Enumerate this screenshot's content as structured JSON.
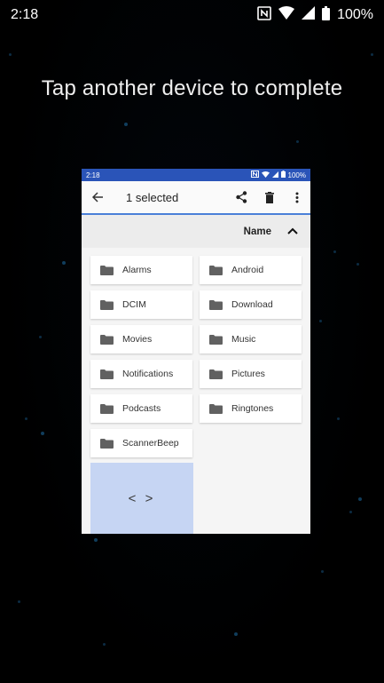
{
  "status_bar": {
    "time": "2:18",
    "battery": "100%",
    "icons": [
      "nfc-icon",
      "wifi-icon",
      "signal-icon",
      "battery-icon"
    ]
  },
  "prompt": "Tap another device to complete",
  "preview": {
    "status_bar": {
      "time": "2:18",
      "battery": "100%"
    },
    "app_bar": {
      "title": "1 selected",
      "actions": [
        "share-icon",
        "delete-icon",
        "more-vert-icon"
      ]
    },
    "sort_bar": {
      "label": "Name",
      "direction": "ascending"
    },
    "folders": [
      "Alarms",
      "Android",
      "DCIM",
      "Download",
      "Movies",
      "Music",
      "Notifications",
      "Pictures",
      "Podcasts",
      "Ringtones",
      "ScannerBeep"
    ],
    "tile": {
      "icon": "code-icon",
      "label": "< >"
    }
  },
  "colors": {
    "accent": "#2a54b8",
    "selection": "#c6d5f3",
    "star": "#1d6fa8"
  }
}
